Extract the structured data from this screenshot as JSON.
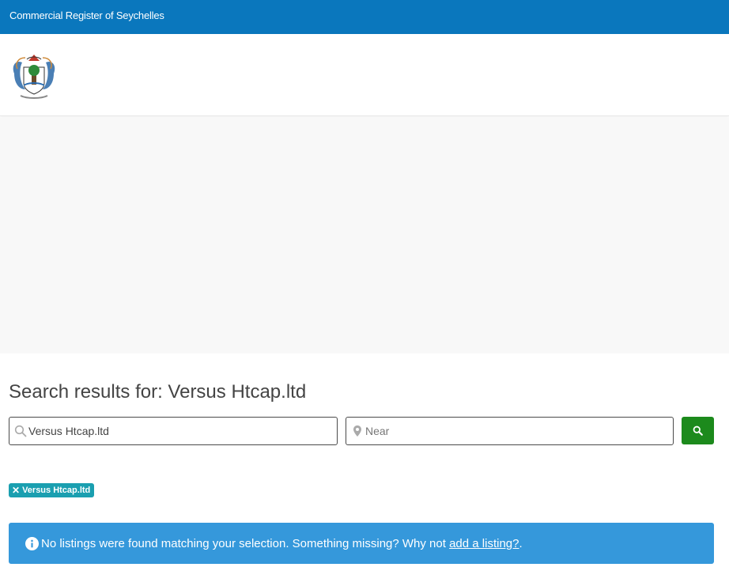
{
  "topbar": {
    "site_name": "Commercial Register of Seychelles"
  },
  "header": {
    "logo_icon": "seychelles-coat-of-arms-icon"
  },
  "results": {
    "title": "Search results for: Versus Htcap.ltd"
  },
  "search": {
    "keyword_value": "Versus Htcap.ltd",
    "keyword_icon": "search-icon",
    "location_placeholder": "Near",
    "location_icon": "map-pin-icon",
    "submit_icon": "search-icon"
  },
  "filter_chip": {
    "remove_glyph": "✕",
    "label": "Versus Htcap.ltd"
  },
  "notice": {
    "icon": "info-icon",
    "text": "No listings were found matching your selection. Something missing? Why not ",
    "link_label": "add a listing?",
    "suffix": "."
  },
  "colors": {
    "topbar": "#0a77bd",
    "search_button": "#1c8a1c",
    "chip": "#1a9fb0",
    "notice": "#3598db"
  }
}
